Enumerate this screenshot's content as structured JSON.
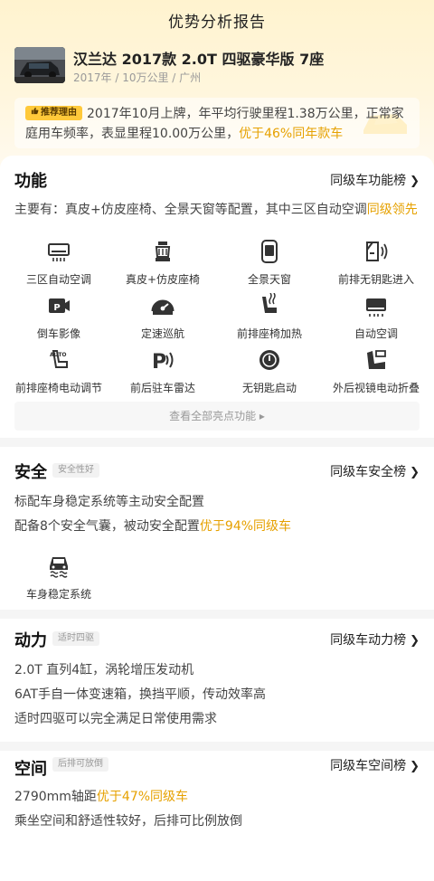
{
  "page_title": "优势分析报告",
  "car": {
    "name": "汉兰达 2017款 2.0T 四驱豪华版 7座",
    "meta": "2017年 / 10万公里 / 广州"
  },
  "recommend": {
    "badge": "推荐理由",
    "text_plain": "2017年10月上牌，年平均行驶里程1.38万公里，正常家庭用车频率，表显里程10.00万公里，",
    "text_highlight": "优于46%同年款车"
  },
  "features": {
    "title": "功能",
    "rank_link": "同级车功能榜",
    "summary_plain": "主要有：真皮+仿皮座椅、全景天窗等配置，其中三区自动空调",
    "summary_highlight": "同级领先",
    "items": [
      {
        "label": "三区自动空调",
        "icon": "ac-three-zone-icon"
      },
      {
        "label": "真皮+仿皮座椅",
        "icon": "leather-seat-icon"
      },
      {
        "label": "全景天窗",
        "icon": "panoramic-sunroof-icon"
      },
      {
        "label": "前排无钥匙进入",
        "icon": "keyless-entry-icon"
      },
      {
        "label": "倒车影像",
        "icon": "reverse-camera-icon"
      },
      {
        "label": "定速巡航",
        "icon": "cruise-control-icon"
      },
      {
        "label": "前排座椅加热",
        "icon": "seat-heating-icon"
      },
      {
        "label": "自动空调",
        "icon": "auto-ac-icon"
      },
      {
        "label": "前排座椅电动调节",
        "icon": "power-seat-icon"
      },
      {
        "label": "前后驻车雷达",
        "icon": "parking-radar-icon"
      },
      {
        "label": "无钥匙启动",
        "icon": "keyless-start-icon"
      },
      {
        "label": "外后视镜电动折叠",
        "icon": "mirror-fold-icon"
      }
    ],
    "view_all": "查看全部亮点功能"
  },
  "safety": {
    "title": "安全",
    "tag": "安全性好",
    "rank_link": "同级车安全榜",
    "line1": "标配车身稳定系统等主动安全配置",
    "line2_plain": "配备8个安全气囊，被动安全配置",
    "line2_highlight": "优于94%同级车",
    "item_label": "车身稳定系统",
    "item_icon": "stability-control-icon"
  },
  "power": {
    "title": "动力",
    "tag": "适时四驱",
    "rank_link": "同级车动力榜",
    "lines": [
      "2.0T 直列4缸，涡轮增压发动机",
      "6AT手自一体变速箱，换挡平顺，传动效率高",
      "适时四驱可以完全满足日常使用需求"
    ]
  },
  "space": {
    "title": "空间",
    "tag": "后排可放倒",
    "rank_link": "同级车空间榜",
    "line1_plain": "2790mm轴距",
    "line1_highlight": "优于47%同级车",
    "line2": "乘坐空间和舒适性较好，后排可比例放倒"
  },
  "colors": {
    "accent": "#e6a100",
    "badge": "#ffc93a"
  }
}
